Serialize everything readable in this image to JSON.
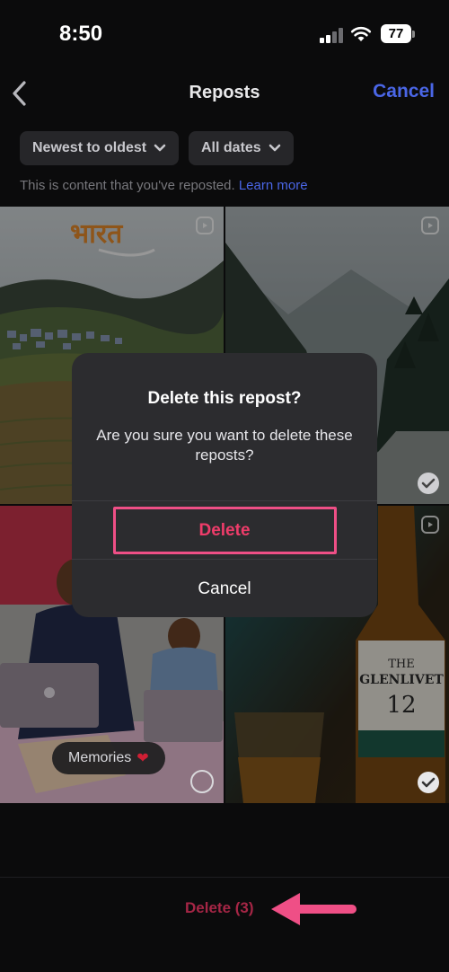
{
  "status_bar": {
    "time": "8:50",
    "battery": "77"
  },
  "header": {
    "title": "Reposts",
    "cancel_label": "Cancel"
  },
  "filters": {
    "sort_label": "Newest to oldest",
    "date_label": "All dates"
  },
  "hint": {
    "text": "This is content that you've reposted.",
    "link": "Learn more"
  },
  "grid": {
    "tiles": [
      {
        "overlay_text": "भारत",
        "selected": false
      },
      {
        "selected": true
      },
      {
        "selected": false,
        "chip_label": "Memories"
      },
      {
        "selected": true
      }
    ]
  },
  "dialog": {
    "title": "Delete this repost?",
    "message": "Are you sure you want to delete these reposts?",
    "delete_label": "Delete",
    "cancel_label": "Cancel"
  },
  "bottom_bar": {
    "delete_label": "Delete (3)"
  },
  "colors": {
    "accent_blue": "#4a66e6",
    "destructive": "#ef3c6a",
    "annotation_pink": "#ef4f86"
  }
}
